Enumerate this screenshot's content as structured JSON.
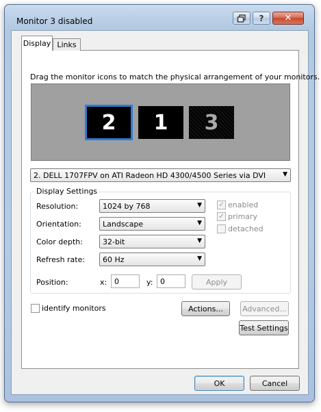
{
  "window": {
    "title": "Monitor 3 disabled",
    "restore_icon": "restore-icon",
    "help_label": "?",
    "close_label": "✕"
  },
  "tabs": [
    {
      "label": "Display"
    },
    {
      "label": "Links"
    }
  ],
  "instructions": "Drag the monitor icons to match the physical arrangement of your monitors.",
  "monitors": [
    {
      "label": "2",
      "state": "selected"
    },
    {
      "label": "1"
    },
    {
      "label": "3",
      "state": "disabled"
    }
  ],
  "monitor_select": {
    "value": "2. DELL 1707FPV on ATI Radeon HD 4300/4500 Series via DVI"
  },
  "display_settings": {
    "group_label": "Display Settings",
    "resolution": {
      "label": "Resolution:",
      "value": "1024 by 768"
    },
    "orientation": {
      "label": "Orientation:",
      "value": "Landscape"
    },
    "color_depth": {
      "label": "Color depth:",
      "value": "32-bit"
    },
    "refresh_rate": {
      "label": "Refresh rate:",
      "value": "60 Hz"
    },
    "position": {
      "label": "Position:",
      "x_label": "x:",
      "x_value": "0",
      "y_label": "y:",
      "y_value": "0"
    },
    "apply_label": "Apply",
    "checkboxes": {
      "enabled": {
        "label": "enabled",
        "checked": true
      },
      "primary": {
        "label": "primary",
        "checked": true
      },
      "detached": {
        "label": "detached",
        "checked": false
      }
    }
  },
  "identify_monitors": {
    "label": "identify monitors",
    "checked": false
  },
  "buttons": {
    "actions": "Actions...",
    "advanced": "Advanced...",
    "test": "Test Settings",
    "ok": "OK",
    "cancel": "Cancel"
  },
  "colors": {
    "selection": "#2d7bd6",
    "arrangement_bg": "#a0a0a0"
  }
}
